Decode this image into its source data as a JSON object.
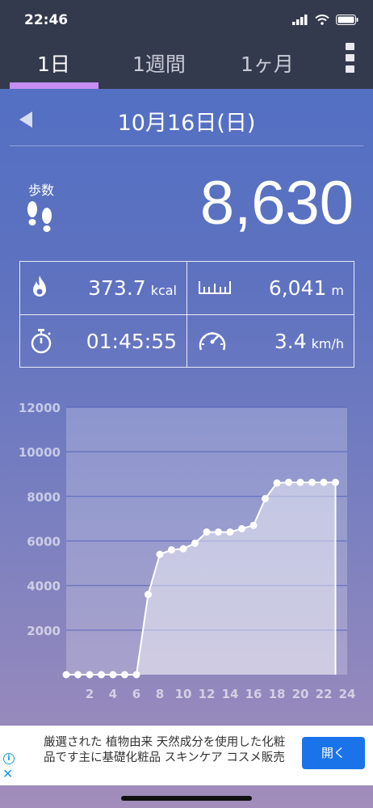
{
  "status_bar": {
    "time": "22:46"
  },
  "tabs": [
    {
      "label": "1日",
      "active": true
    },
    {
      "label": "1週間",
      "active": false
    },
    {
      "label": "1ヶ月",
      "active": false
    }
  ],
  "date": {
    "label": "10月16日(日)"
  },
  "steps": {
    "label": "歩数",
    "value": "8,630"
  },
  "stats": {
    "calories": {
      "value": "373.7",
      "unit": "kcal"
    },
    "distance": {
      "value": "6,041",
      "unit": "m"
    },
    "duration": {
      "value": "01:45:55",
      "unit": ""
    },
    "speed": {
      "value": "3.4",
      "unit": "km/h"
    }
  },
  "chart_data": {
    "type": "area",
    "x": [
      0,
      1,
      2,
      3,
      4,
      5,
      6,
      7,
      8,
      9,
      10,
      11,
      12,
      13,
      14,
      15,
      16,
      17,
      18,
      19,
      20,
      21,
      22,
      23
    ],
    "values": [
      0,
      0,
      0,
      0,
      0,
      0,
      0,
      3600,
      5400,
      5600,
      5650,
      5900,
      6400,
      6400,
      6400,
      6550,
      6700,
      7900,
      8600,
      8630,
      8630,
      8630,
      8630,
      8630
    ],
    "xticks": [
      "2",
      "4",
      "6",
      "8",
      "10",
      "12",
      "14",
      "16",
      "18",
      "20",
      "22",
      "24"
    ],
    "yticks": [
      "2000",
      "4000",
      "6000",
      "8000",
      "10000",
      "12000"
    ],
    "xlim": [
      0,
      24
    ],
    "ylim": [
      0,
      12000
    ],
    "grid": true
  },
  "colors": {
    "header_bg": "#333a4d",
    "tab_indicator": "#c58ef0",
    "ad_button": "#1a73e8"
  },
  "ad": {
    "text": "厳選された 植物由来 天然成分を使用した化粧品です主に基礎化粧品 スキンケア コスメ販売",
    "button_label": "開く"
  }
}
